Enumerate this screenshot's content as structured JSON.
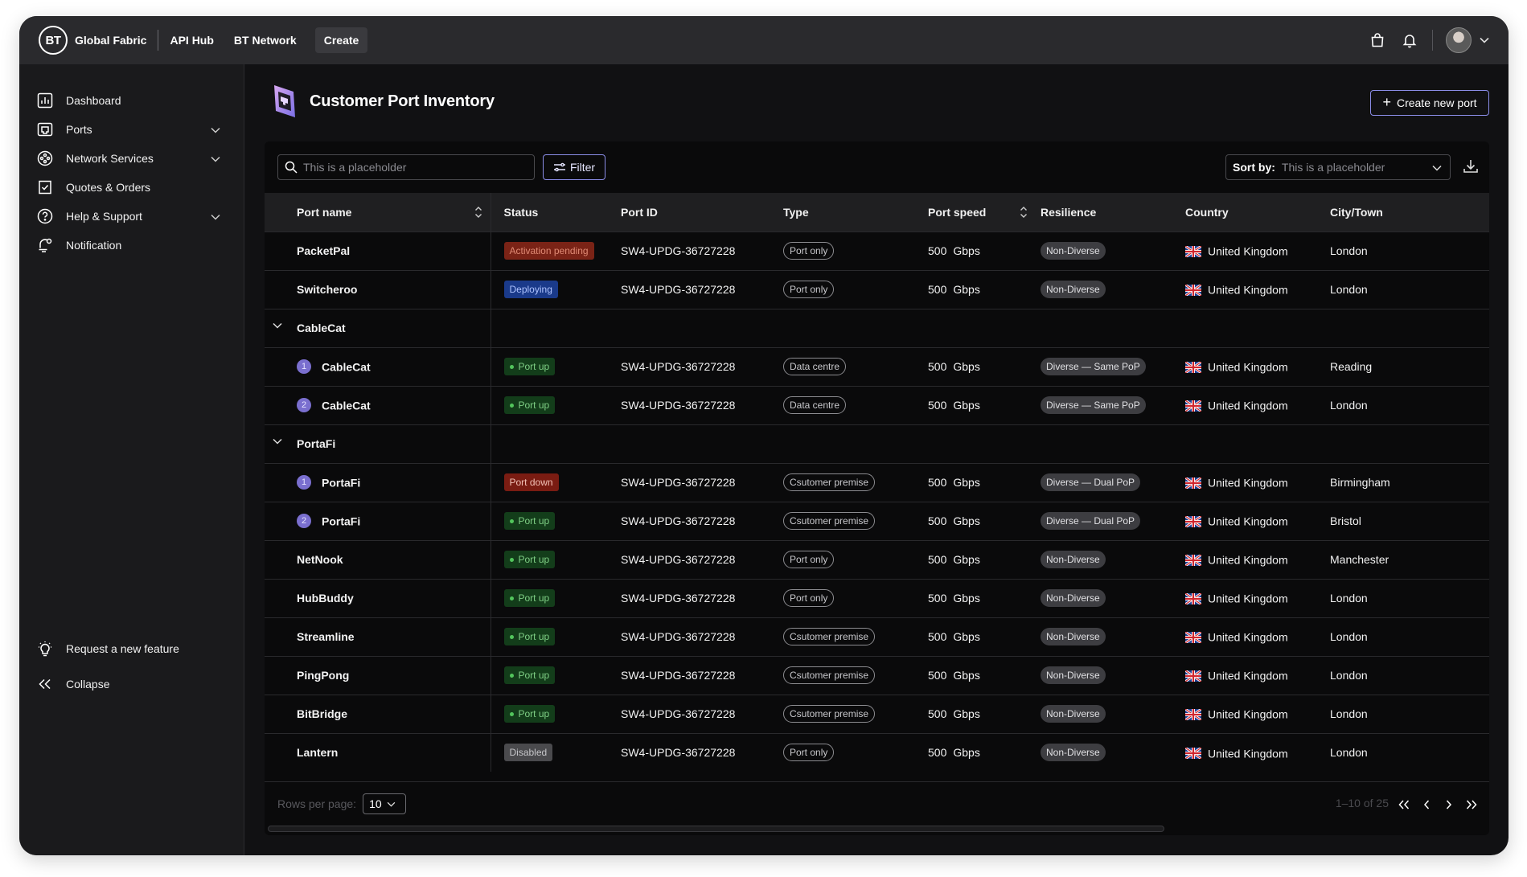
{
  "topbar": {
    "logo_text": "BT",
    "brand": "Global Fabric",
    "nav": [
      "API Hub",
      "BT Network"
    ],
    "create_label": "Create"
  },
  "sidebar": {
    "items": [
      {
        "label": "Dashboard",
        "icon": "dashboard-icon",
        "expandable": false
      },
      {
        "label": "Ports",
        "icon": "port-icon",
        "expandable": true
      },
      {
        "label": "Network Services",
        "icon": "network-icon",
        "expandable": true
      },
      {
        "label": "Quotes & Orders",
        "icon": "quotes-icon",
        "expandable": false
      },
      {
        "label": "Help & Support",
        "icon": "help-icon",
        "expandable": true
      },
      {
        "label": "Notification",
        "icon": "notification-icon",
        "expandable": false
      }
    ],
    "bottom": {
      "request_feature": "Request a new feature",
      "collapse": "Collapse"
    }
  },
  "page": {
    "title": "Customer Port Inventory",
    "create_button": "Create new port"
  },
  "toolbar": {
    "search_placeholder": "This is a placeholder",
    "filter_label": "Filter",
    "sort_label": "Sort by:",
    "sort_placeholder": "This is a placeholder"
  },
  "table": {
    "columns": [
      "Port name",
      "Status",
      "Port ID",
      "Type",
      "Port speed",
      "Resilience",
      "Country",
      "City/Town"
    ],
    "rows": [
      {
        "kind": "row",
        "name": "PacketPal",
        "status": "Activation pending",
        "status_type": "pending",
        "port_id": "SW4-UPDG-36727228",
        "type": "Port only",
        "speed": "500",
        "unit": "Gbps",
        "resilience": "Non-Diverse",
        "country": "United Kingdom",
        "city": "London"
      },
      {
        "kind": "row",
        "name": "Switcheroo",
        "status": "Deploying",
        "status_type": "deploy",
        "port_id": "SW4-UPDG-36727228",
        "type": "Port only",
        "speed": "500",
        "unit": "Gbps",
        "resilience": "Non-Diverse",
        "country": "United Kingdom",
        "city": "London"
      },
      {
        "kind": "group",
        "name": "CableCat"
      },
      {
        "kind": "sub",
        "num": "1",
        "name": "CableCat",
        "status": "Port up",
        "status_type": "up",
        "port_id": "SW4-UPDG-36727228",
        "type": "Data centre",
        "speed": "500",
        "unit": "Gbps",
        "resilience": "Diverse — Same PoP",
        "country": "United Kingdom",
        "city": "Reading"
      },
      {
        "kind": "sub",
        "num": "2",
        "name": "CableCat",
        "status": "Port up",
        "status_type": "up",
        "port_id": "SW4-UPDG-36727228",
        "type": "Data centre",
        "speed": "500",
        "unit": "Gbps",
        "resilience": "Diverse — Same PoP",
        "country": "United Kingdom",
        "city": "London"
      },
      {
        "kind": "group",
        "name": "PortaFi"
      },
      {
        "kind": "sub",
        "num": "1",
        "name": "PortaFi",
        "status": "Port down",
        "status_type": "down",
        "port_id": "SW4-UPDG-36727228",
        "type": "Csutomer premise",
        "speed": "500",
        "unit": "Gbps",
        "resilience": "Diverse — Dual PoP",
        "country": "United Kingdom",
        "city": "Birmingham"
      },
      {
        "kind": "sub",
        "num": "2",
        "name": "PortaFi",
        "status": "Port up",
        "status_type": "up",
        "port_id": "SW4-UPDG-36727228",
        "type": "Csutomer premise",
        "speed": "500",
        "unit": "Gbps",
        "resilience": "Diverse — Dual PoP",
        "country": "United Kingdom",
        "city": "Bristol"
      },
      {
        "kind": "row",
        "name": "NetNook",
        "status": "Port up",
        "status_type": "up",
        "port_id": "SW4-UPDG-36727228",
        "type": "Port only",
        "speed": "500",
        "unit": "Gbps",
        "resilience": "Non-Diverse",
        "country": "United Kingdom",
        "city": "Manchester"
      },
      {
        "kind": "row",
        "name": "HubBuddy",
        "status": "Port up",
        "status_type": "up",
        "port_id": "SW4-UPDG-36727228",
        "type": "Port only",
        "speed": "500",
        "unit": "Gbps",
        "resilience": "Non-Diverse",
        "country": "United Kingdom",
        "city": "London"
      },
      {
        "kind": "row",
        "name": "Streamline",
        "status": "Port up",
        "status_type": "up",
        "port_id": "SW4-UPDG-36727228",
        "type": "Csutomer premise",
        "speed": "500",
        "unit": "Gbps",
        "resilience": "Non-Diverse",
        "country": "United Kingdom",
        "city": "London"
      },
      {
        "kind": "row",
        "name": "PingPong",
        "status": "Port up",
        "status_type": "up",
        "port_id": "SW4-UPDG-36727228",
        "type": "Csutomer premise",
        "speed": "500",
        "unit": "Gbps",
        "resilience": "Non-Diverse",
        "country": "United Kingdom",
        "city": "London"
      },
      {
        "kind": "row",
        "name": "BitBridge",
        "status": "Port up",
        "status_type": "up",
        "port_id": "SW4-UPDG-36727228",
        "type": "Csutomer premise",
        "speed": "500",
        "unit": "Gbps",
        "resilience": "Non-Diverse",
        "country": "United Kingdom",
        "city": "London"
      },
      {
        "kind": "row",
        "name": "Lantern",
        "status": "Disabled",
        "status_type": "disabled",
        "port_id": "SW4-UPDG-36727228",
        "type": "Port only",
        "speed": "500",
        "unit": "Gbps",
        "resilience": "Non-Diverse",
        "country": "United Kingdom",
        "city": "London"
      }
    ]
  },
  "pagination": {
    "rows_per_page_label": "Rows per page:",
    "rows_per_page": "10",
    "range": "1–10 of 25"
  },
  "colors": {
    "accent": "#8b8de8",
    "status_up": "#52c55c",
    "status_down": "#7a1c12",
    "status_pending": "#7a2316",
    "status_deploy": "#1a3a8a"
  }
}
